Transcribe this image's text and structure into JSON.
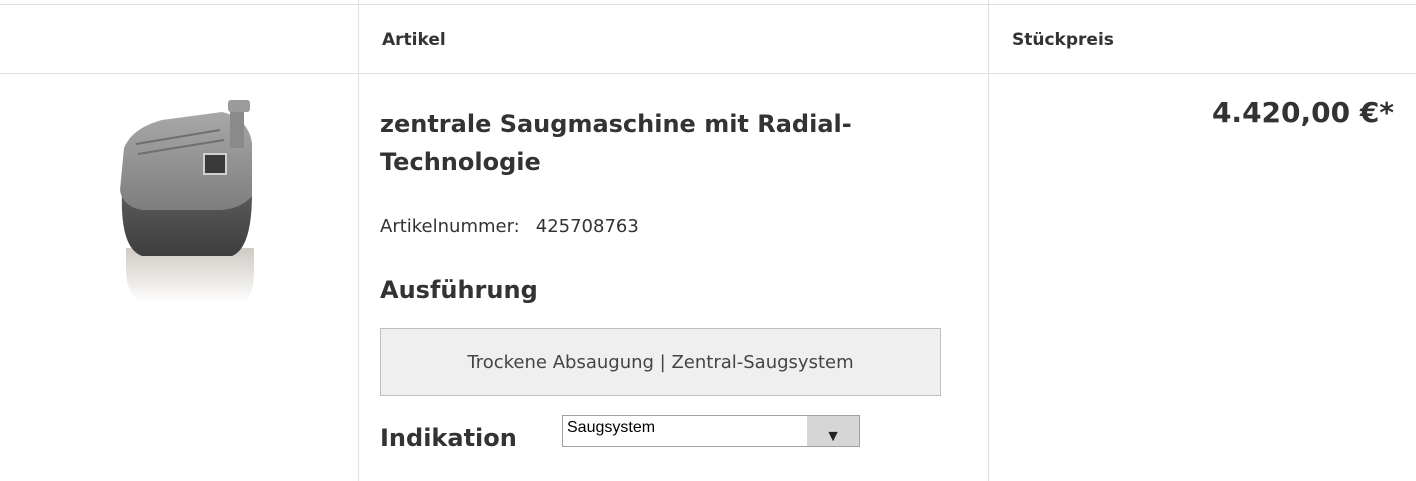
{
  "table": {
    "headers": {
      "article": "Artikel",
      "unit_price": "Stückpreis"
    }
  },
  "product": {
    "title": "zentrale Saugmaschine mit Radial-Technologie",
    "article_number_label": "Artikelnummer:",
    "article_number": "425708763",
    "price": "4.420,00 €*",
    "image_icon": "suction-machine-image",
    "variant": {
      "heading": "Ausführung",
      "option": "Trockene Absaugung | Zentral-Saugsystem"
    },
    "indication": {
      "label": "Indikation",
      "selected": "Saugsystem",
      "arrow_icon": "▼"
    }
  }
}
